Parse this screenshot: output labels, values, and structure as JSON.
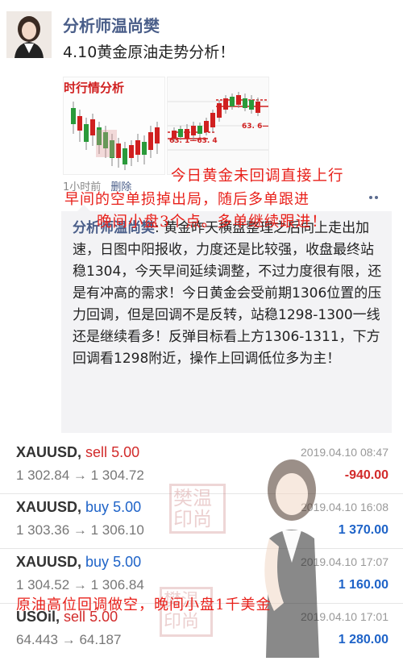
{
  "post": {
    "author": "分析师温尚樊",
    "text": "4.10黄金原油走势分析！",
    "image1_title": "时行情分析",
    "image2_labels": {
      "a": "63. 1—63. 4",
      "b": "63. 6—63."
    },
    "meta_time": "1小时前",
    "meta_delete": "删除"
  },
  "overlay": {
    "line1": "今日黄金未回调直接上行",
    "line2": "早间的空单损掉出局，随后多单跟进",
    "line3": "晚间小盘3个点。多单继续跟进！",
    "line4": "原油高位回调做空，晚间小盘1千美金"
  },
  "comment": {
    "name": "分析师温尚樊",
    "text": ": 黄金昨天横盘整理之后向上走出加速，日图中阳报收，力度还是比较强，收盘最终站稳1304，今天早间延续调整，不过力度很有限，还是有冲高的需求！今日黄金会受前期1306位置的压力回调，但是回调不是反转，站稳1298-1300一线还是继续看多！反弹目标看上方1306-1311，下方回调看1298附近，操作上回调低位多为主！"
  },
  "trades": [
    {
      "symbol": "XAUUSD",
      "direction": "sell",
      "lots": "5.00",
      "prices": "1 302.84 → 1 304.72",
      "datetime": "2019.04.10 08:47",
      "pl": "-940.00"
    },
    {
      "symbol": "XAUUSD",
      "direction": "buy",
      "lots": "5.00",
      "prices": "1 303.36 → 1 306.10",
      "datetime": "2019.04.10 16:08",
      "pl": "1 370.00"
    },
    {
      "symbol": "XAUUSD",
      "direction": "buy",
      "lots": "5.00",
      "prices": "1 304.52 → 1 306.84",
      "datetime": "2019.04.10 17:07",
      "pl": "1 160.00"
    },
    {
      "symbol": "USOil",
      "direction": "sell",
      "lots": "5.00",
      "prices": "64.443 → 64.187",
      "datetime": "2019.04.10 17:01",
      "pl": "1 280.00"
    }
  ],
  "watermark": {
    "stamp1": "樊温印尚",
    "stamp2": "樊温印尚"
  },
  "colors": {
    "sell": "#d22b2b",
    "buy": "#1e63c8",
    "overlay": "#e8201a",
    "author": "#4a5e89"
  }
}
